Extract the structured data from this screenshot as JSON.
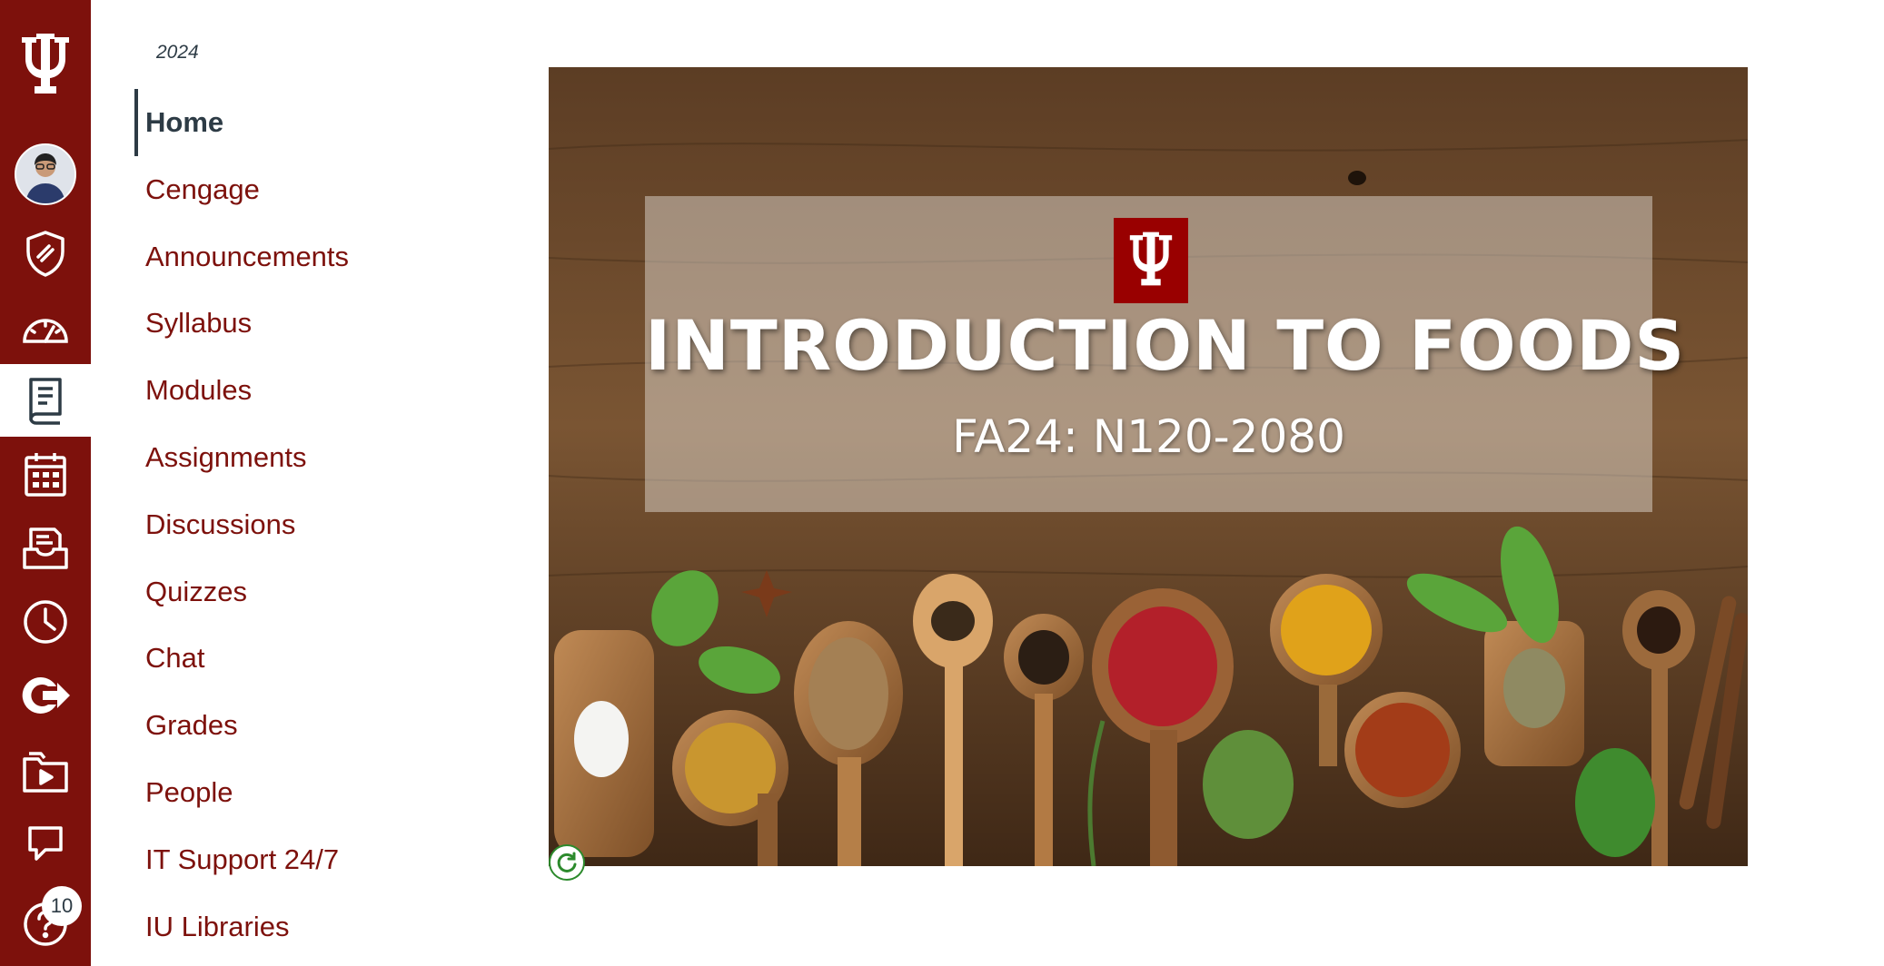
{
  "global_nav": {
    "logo_icon": "iu-trident-icon",
    "items": [
      {
        "icon": "account-avatar"
      },
      {
        "icon": "admin-shield-icon"
      },
      {
        "icon": "dashboard-icon"
      },
      {
        "icon": "courses-icon",
        "active": true
      },
      {
        "icon": "calendar-icon"
      },
      {
        "icon": "inbox-icon"
      },
      {
        "icon": "history-icon"
      },
      {
        "icon": "commons-icon"
      },
      {
        "icon": "studio-icon"
      },
      {
        "icon": "feedback-icon"
      },
      {
        "icon": "help-icon"
      }
    ],
    "help_badge_count": "10",
    "colors": {
      "nav_bg": "#7d110c",
      "active_bg": "#ffffff",
      "icon": "#ffffff"
    }
  },
  "course_nav": {
    "term": "2024",
    "items": [
      {
        "label": "Home",
        "active": true
      },
      {
        "label": "Cengage"
      },
      {
        "label": "Announcements"
      },
      {
        "label": "Syllabus"
      },
      {
        "label": "Modules"
      },
      {
        "label": "Assignments"
      },
      {
        "label": "Discussions"
      },
      {
        "label": "Quizzes"
      },
      {
        "label": "Chat"
      },
      {
        "label": "Grades"
      },
      {
        "label": "People"
      },
      {
        "label": "IT Support 24/7"
      },
      {
        "label": "IU Libraries"
      }
    ],
    "colors": {
      "link": "#7d110c",
      "active": "#2d3b45"
    }
  },
  "banner": {
    "title": "INTRODUCTION TO FOODS",
    "subtitle": "FA24: N120-2080",
    "logo_icon": "iu-trident-icon",
    "colors": {
      "logo_box": "#990000",
      "wood": "#6b4a2e"
    }
  }
}
